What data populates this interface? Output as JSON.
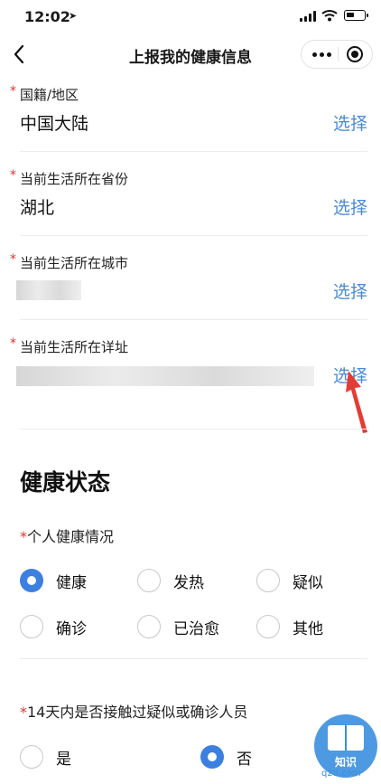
{
  "status_bar": {
    "time": "12:02",
    "battery_level": 0.45
  },
  "nav": {
    "title": "上报我的健康信息"
  },
  "form": {
    "fields": [
      {
        "label": "国籍/地区",
        "value": "中国大陆",
        "action": "选择"
      },
      {
        "label": "当前生活所在省份",
        "value": "湖北",
        "action": "选择"
      },
      {
        "label": "当前生活所在城市",
        "value": "",
        "action": "选择"
      },
      {
        "label": "当前生活所在详址",
        "value": "",
        "action": "选择"
      }
    ],
    "required_mark": "*"
  },
  "health": {
    "section_title": "健康状态",
    "q1": {
      "label": "个人健康情况",
      "options": [
        "健康",
        "发热",
        "疑似",
        "确诊",
        "已治愈",
        "其他"
      ],
      "selected": "健康"
    },
    "q2": {
      "label": "14天内是否接触过疑似或确诊人员",
      "options": [
        "是",
        "否"
      ],
      "selected": "否"
    }
  },
  "watermark": {
    "caption": "知识",
    "site": "q2d.com"
  },
  "colors": {
    "accent": "#3b7fe0",
    "link": "#4a8ad6",
    "required": "#e0332c",
    "arrow": "#e53b35"
  }
}
